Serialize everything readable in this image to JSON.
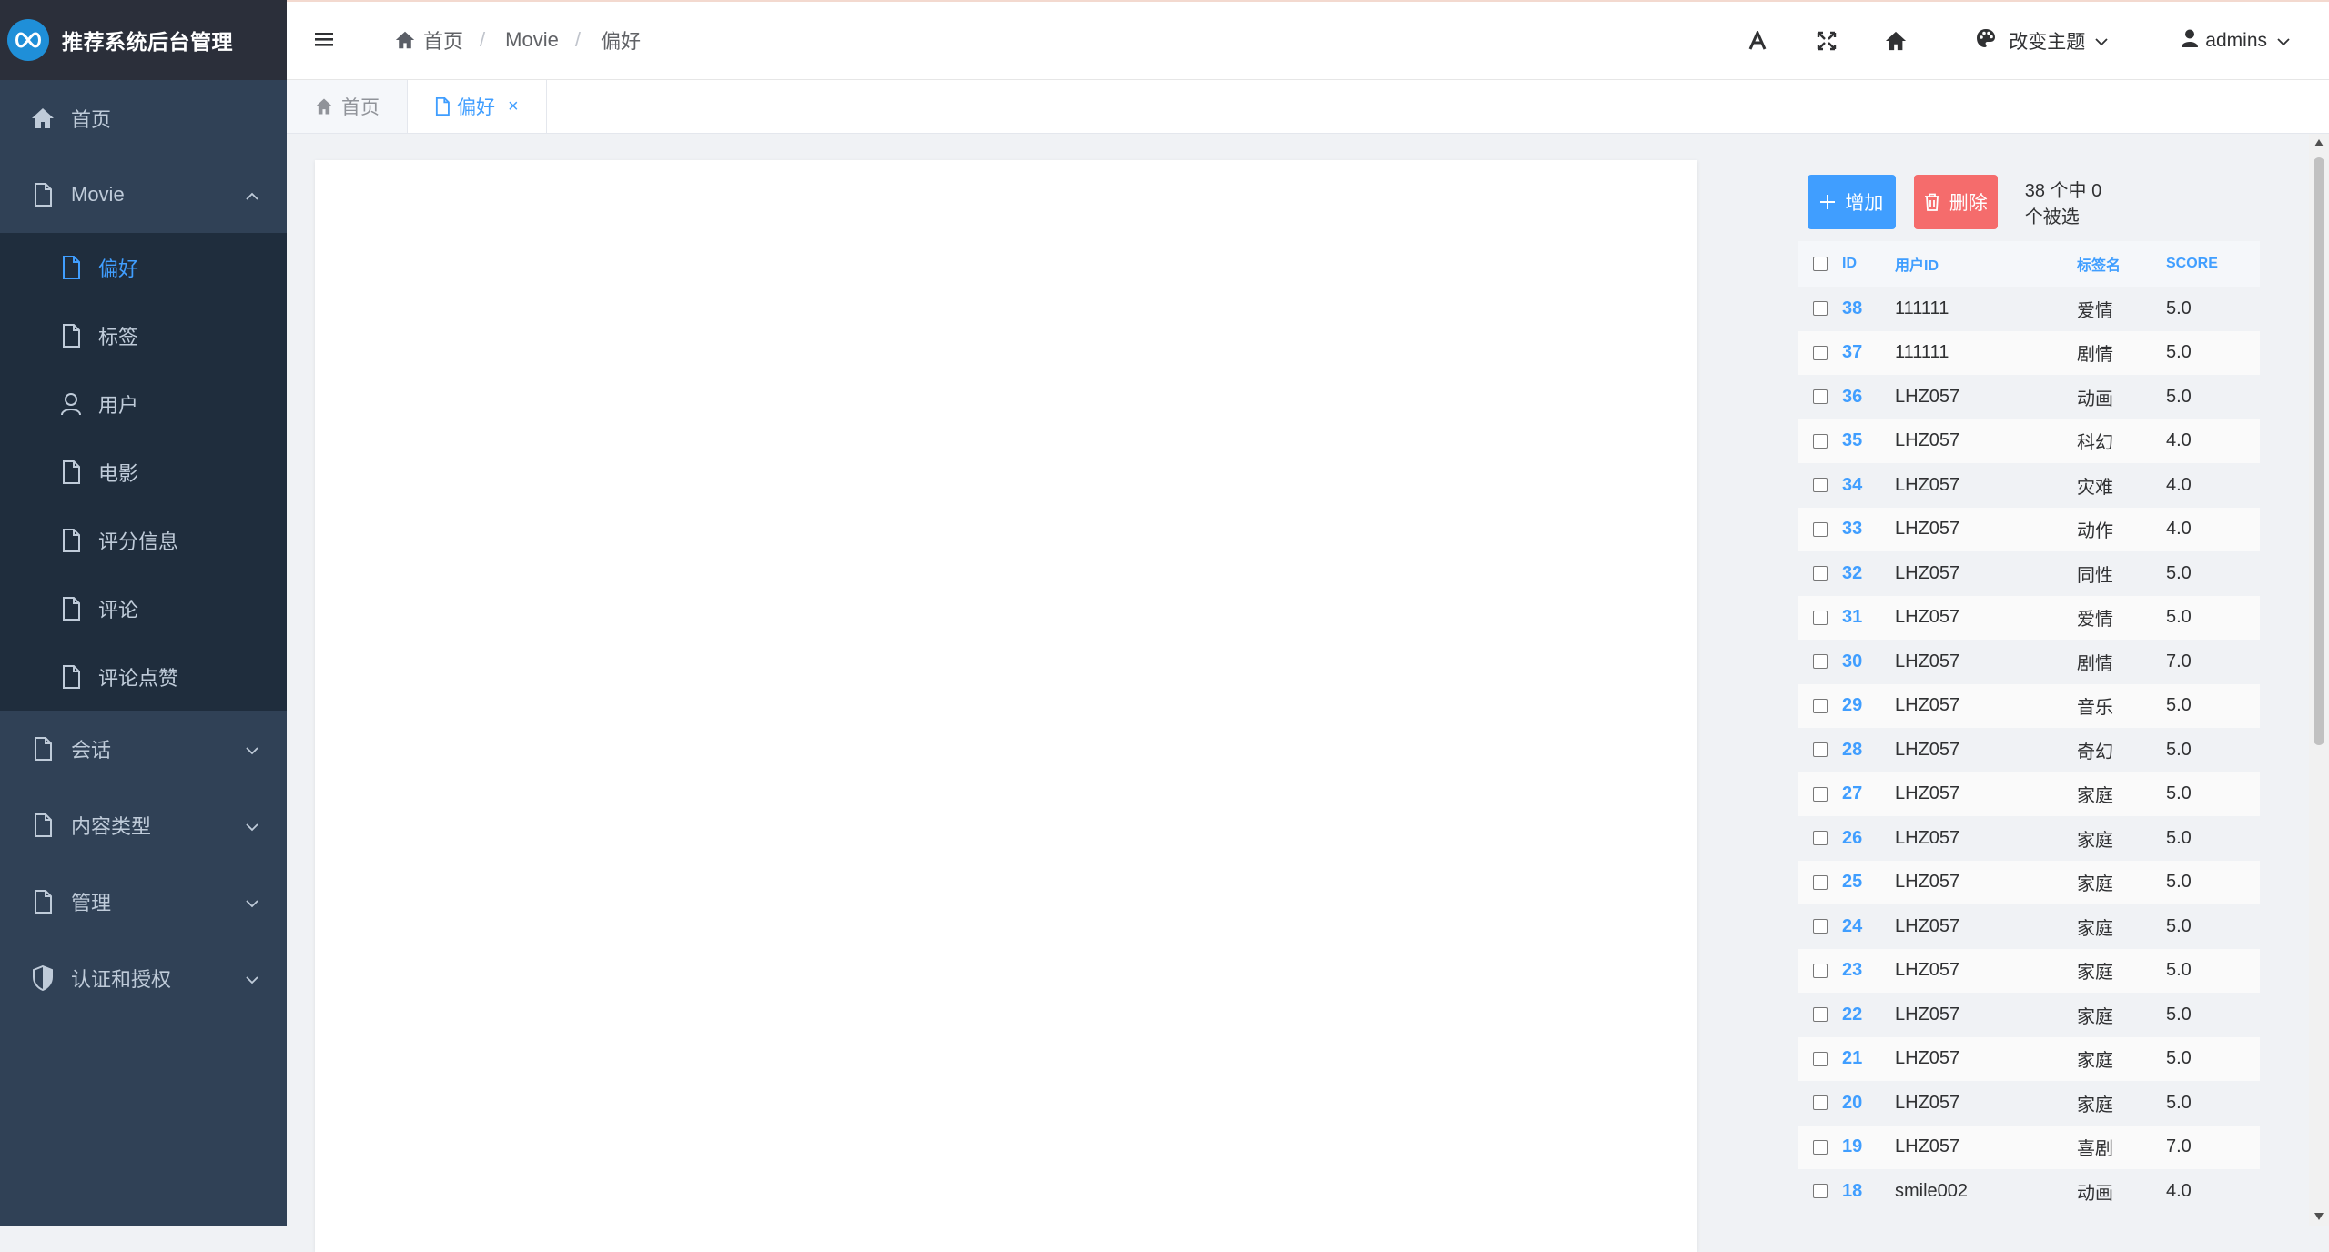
{
  "app": {
    "title": "推荐系统后台管理"
  },
  "sidebar": {
    "home": "首页",
    "movie": {
      "label": "Movie",
      "children": [
        "偏好",
        "标签",
        "用户",
        "电影",
        "评分信息",
        "评论",
        "评论点赞"
      ]
    },
    "session": "会话",
    "content_type": "内容类型",
    "manage": "管理",
    "auth": "认证和授权"
  },
  "navbar": {
    "breadcrumb": [
      "首页",
      "Movie",
      "偏好"
    ],
    "theme_label": "改变主题",
    "username": "admins"
  },
  "tags": {
    "home": "首页",
    "current": "偏好",
    "close": "×"
  },
  "toolbar": {
    "add_label": "增加",
    "delete_label": "删除",
    "selection_text": "38 个中 0 个被选"
  },
  "table": {
    "headers": {
      "id": "ID",
      "user_id": "用户ID",
      "tag": "标签名",
      "score": "SCORE"
    },
    "rows": [
      {
        "id": "38",
        "user": "111111",
        "tag": "爱情",
        "score": "5.0"
      },
      {
        "id": "37",
        "user": "111111",
        "tag": "剧情",
        "score": "5.0"
      },
      {
        "id": "36",
        "user": "LHZ057",
        "tag": "动画",
        "score": "5.0"
      },
      {
        "id": "35",
        "user": "LHZ057",
        "tag": "科幻",
        "score": "4.0"
      },
      {
        "id": "34",
        "user": "LHZ057",
        "tag": "灾难",
        "score": "4.0"
      },
      {
        "id": "33",
        "user": "LHZ057",
        "tag": "动作",
        "score": "4.0"
      },
      {
        "id": "32",
        "user": "LHZ057",
        "tag": "同性",
        "score": "5.0"
      },
      {
        "id": "31",
        "user": "LHZ057",
        "tag": "爱情",
        "score": "5.0"
      },
      {
        "id": "30",
        "user": "LHZ057",
        "tag": "剧情",
        "score": "7.0"
      },
      {
        "id": "29",
        "user": "LHZ057",
        "tag": "音乐",
        "score": "5.0"
      },
      {
        "id": "28",
        "user": "LHZ057",
        "tag": "奇幻",
        "score": "5.0"
      },
      {
        "id": "27",
        "user": "LHZ057",
        "tag": "家庭",
        "score": "5.0"
      },
      {
        "id": "26",
        "user": "LHZ057",
        "tag": "家庭",
        "score": "5.0"
      },
      {
        "id": "25",
        "user": "LHZ057",
        "tag": "家庭",
        "score": "5.0"
      },
      {
        "id": "24",
        "user": "LHZ057",
        "tag": "家庭",
        "score": "5.0"
      },
      {
        "id": "23",
        "user": "LHZ057",
        "tag": "家庭",
        "score": "5.0"
      },
      {
        "id": "22",
        "user": "LHZ057",
        "tag": "家庭",
        "score": "5.0"
      },
      {
        "id": "21",
        "user": "LHZ057",
        "tag": "家庭",
        "score": "5.0"
      },
      {
        "id": "20",
        "user": "LHZ057",
        "tag": "家庭",
        "score": "5.0"
      },
      {
        "id": "19",
        "user": "LHZ057",
        "tag": "喜剧",
        "score": "7.0"
      },
      {
        "id": "18",
        "user": "smile002",
        "tag": "动画",
        "score": "4.0"
      }
    ]
  },
  "colors": {
    "sidebar_bg": "#304156",
    "submenu_bg": "#1f2d3d",
    "logo_bg": "#2b2f3a",
    "primary": "#409eff",
    "danger": "#f56c6c"
  }
}
